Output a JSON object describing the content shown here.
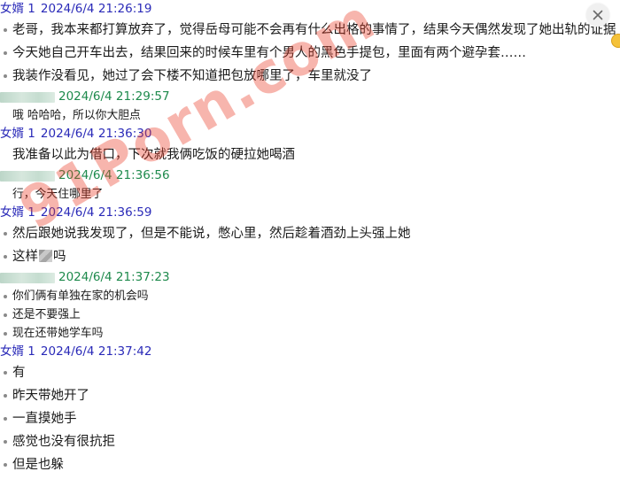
{
  "watermark": {
    "text": "91Porn.com"
  },
  "colors": {
    "sender_a": "#2a2ab8",
    "sender_b": "#1e8a4c",
    "watermark": "#eb3c28"
  },
  "icons": {
    "close": "close-icon",
    "emoji": "emoji-icon",
    "mosaic": "censor-mosaic"
  },
  "messages": [
    {
      "sender": "女婿 1",
      "timestamp": "2024/6/4 21:26:19",
      "lines": [
        "老哥，我本来都打算放弃了，觉得岳母可能不会再有什么出格的事情了，结果今天偶然发现了她出轨的证据",
        "今天她自己开车出去，结果回来的时候车里有个男人的黑色手提包，里面有两个避孕套……",
        "我装作没看见，她过了会下楼不知道把包放哪里了，车里就没了"
      ]
    },
    {
      "sender": "",
      "timestamp": "2024/6/4 21:29:57",
      "lines": [
        "哦 哈哈哈，所以你大胆点"
      ]
    },
    {
      "sender": "女婿 1",
      "timestamp": "2024/6/4 21:36:30",
      "lines": [
        "我准备以此为借口，下次就我俩吃饭的硬拉她喝酒"
      ]
    },
    {
      "sender": "",
      "timestamp": "2024/6/4 21:36:56",
      "lines": [
        "行，今天住哪里了"
      ]
    },
    {
      "sender": "女婿 1",
      "timestamp": "2024/6/4 21:36:59",
      "lines": [
        "然后跟她说我发现了，但是不能说，憋心里，然后趁着酒劲上头强上她"
      ],
      "censored_line": {
        "before": "这样",
        "after": "吗"
      }
    },
    {
      "sender": "",
      "timestamp": "2024/6/4 21:37:23",
      "lines": [
        "你们俩有单独在家的机会吗",
        "还是不要强上",
        "现在还带她学车吗"
      ]
    },
    {
      "sender": "女婿 1",
      "timestamp": "2024/6/4 21:37:42",
      "lines": [
        "有",
        "昨天带她开了",
        "一直摸她手",
        "感觉也没有很抗拒",
        "但是也躲"
      ]
    }
  ]
}
